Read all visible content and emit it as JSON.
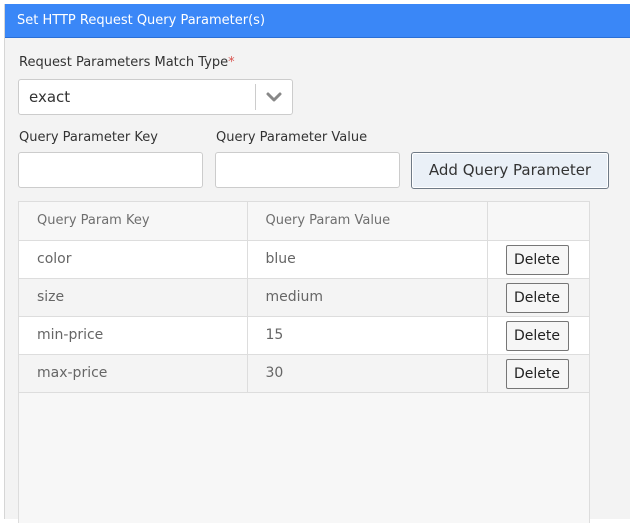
{
  "header": {
    "title": "Set HTTP Request Query Parameter(s)"
  },
  "match_type": {
    "label": "Request Parameters Match Type",
    "required_mark": "*",
    "selected": "exact",
    "icon": "chevron-down-icon"
  },
  "key_field": {
    "label": "Query Parameter Key",
    "value": ""
  },
  "value_field": {
    "label": "Query Parameter Value",
    "value": ""
  },
  "add_button": {
    "label": "Add Query Parameter"
  },
  "table": {
    "columns": [
      "Query Param Key",
      "Query Param Value",
      ""
    ],
    "rows": [
      {
        "key": "color",
        "value": "blue",
        "action": "Delete"
      },
      {
        "key": "size",
        "value": "medium",
        "action": "Delete"
      },
      {
        "key": "min-price",
        "value": "15",
        "action": "Delete"
      },
      {
        "key": "max-price",
        "value": "30",
        "action": "Delete"
      }
    ]
  },
  "colors": {
    "header_bg": "#3a87f7",
    "required": "#d9534f",
    "panel_bg": "#f3f3f3"
  }
}
